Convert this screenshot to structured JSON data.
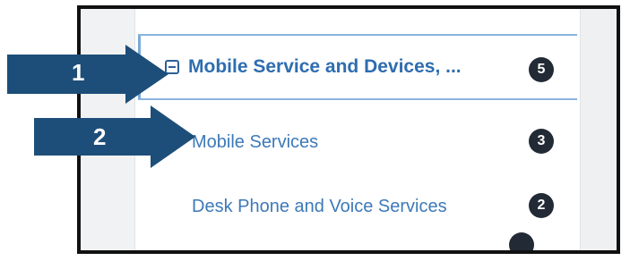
{
  "category": {
    "label": "Mobile Service and Devices, ...",
    "count": "5",
    "icon": "collapse-minus-icon"
  },
  "subcategories": [
    {
      "label": "Mobile Services",
      "count": "3"
    },
    {
      "label": "Desk Phone and Voice Services",
      "count": "2"
    }
  ],
  "callouts": [
    {
      "number": "1"
    },
    {
      "number": "2"
    }
  ],
  "colors": {
    "link": "#3d79b8",
    "parent_link": "#2e6db0",
    "badge": "#222a35",
    "callout_arrow": "#1d4e79",
    "selected_border": "#8ab4dc"
  }
}
